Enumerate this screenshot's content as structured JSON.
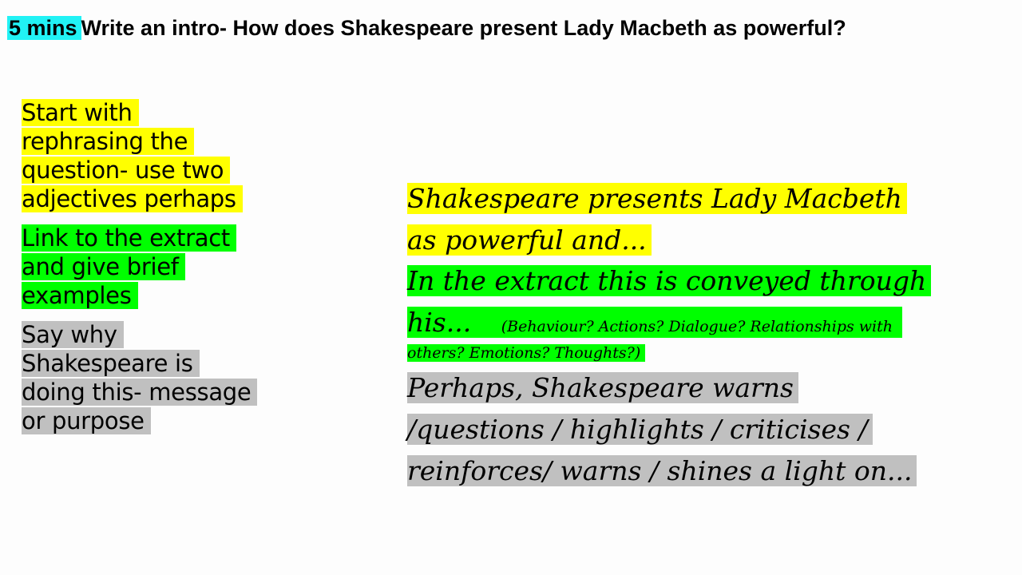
{
  "header": {
    "timer_badge": "5 mins",
    "prompt": "Write an intro- How does Shakespeare present Lady Macbeth as powerful?"
  },
  "guidance": {
    "step1_lines": [
      "Start with",
      "rephrasing the",
      "question- use two",
      "adjectives perhaps"
    ],
    "step2_lines": [
      "Link to the extract",
      "and give brief",
      "examples"
    ],
    "step3_lines": [
      "Say why",
      "Shakespeare is",
      "doing this- message",
      "or purpose"
    ]
  },
  "model_answer": {
    "sentence1_lines": [
      "Shakespeare presents  Lady Macbeth",
      "as powerful and..."
    ],
    "sentence2_line1": "In the extract this is conveyed through",
    "sentence2_line2": "his...",
    "sentence2_hint_part1": "(Behaviour? Actions? Dialogue? Relationships with",
    "sentence2_hint_part2": "others? Emotions? Thoughts?)",
    "sentence3_lines": [
      "Perhaps, Shakespeare warns",
      "/questions / highlights / criticises /",
      "reinforces/ warns / shines a light on..."
    ]
  },
  "colors": {
    "badge": "#21f2f5",
    "yellow_highlight": "#ffff00",
    "green_highlight": "#00ff00",
    "grey_highlight": "#c0c0c0"
  }
}
